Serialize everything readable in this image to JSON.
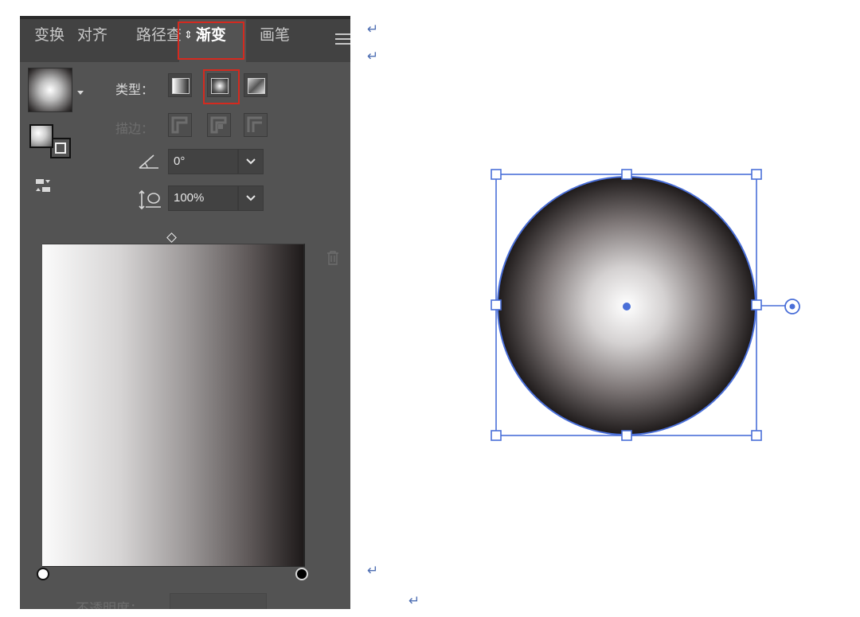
{
  "panel": {
    "tabs": [
      {
        "label": "变换",
        "active": false
      },
      {
        "label": "对齐",
        "active": false
      },
      {
        "label": "路径查",
        "active": false
      },
      {
        "label": "渐变",
        "active": true
      },
      {
        "label": "画笔",
        "active": false
      }
    ],
    "type_label": "类型：",
    "stroke_label": "描边：",
    "angle_value": "0°",
    "aspect_value": "100%",
    "opacity_label": "不透明度：",
    "gradient_type_selected": "radial",
    "icons": {
      "menu": "menu-icon",
      "angle": "angle-icon",
      "aspect": "aspect-ratio-icon",
      "delete": "trash-icon",
      "reverse": "reverse-gradient-icon"
    }
  },
  "canvas": {
    "object": "radial-gradient-circle",
    "selection_color": "#4a6fd8",
    "gradient_stops": [
      "#ffffff",
      "#000000"
    ]
  },
  "colors": {
    "panel_bg": "#535353",
    "tab_bg": "#424242",
    "highlight": "#d42a1f",
    "accent": "#4a6fd8"
  }
}
